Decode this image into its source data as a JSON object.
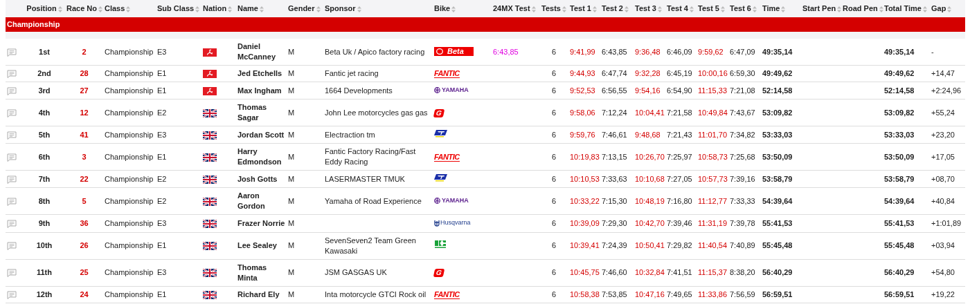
{
  "columns": [
    {
      "label": "Position"
    },
    {
      "label": "Race No"
    },
    {
      "label": "Class"
    },
    {
      "label": "Sub Class"
    },
    {
      "label": "Nation"
    },
    {
      "label": "Name"
    },
    {
      "label": "Gender"
    },
    {
      "label": "Sponsor"
    },
    {
      "label": "Bike"
    },
    {
      "label": "24MX Test"
    },
    {
      "label": "Tests"
    },
    {
      "label": "Test 1",
      "highlight": true
    },
    {
      "label": "Test 2",
      "highlight": false
    },
    {
      "label": "Test 3",
      "highlight": true
    },
    {
      "label": "Test 4",
      "highlight": false
    },
    {
      "label": "Test 5",
      "highlight": true
    },
    {
      "label": "Test 6",
      "highlight": false
    },
    {
      "label": "Time"
    },
    {
      "label": "Start Pen"
    },
    {
      "label": "Road Pen"
    },
    {
      "label": "Total Time"
    },
    {
      "label": "Gap"
    }
  ],
  "group": "Championship",
  "rows": [
    {
      "position": "1st",
      "race_no": "2",
      "class": "Championship",
      "sub_class": "E3",
      "nation": {
        "kind": "iom"
      },
      "name": "Daniel McCanney",
      "gender": "M",
      "sponsor": "Beta Uk / Apico factory racing",
      "bike": {
        "kind": "beta",
        "label": "Beta"
      },
      "mx_test": "6:43,85",
      "tests": "6",
      "test_times": [
        "9:41,99",
        "6:43,85",
        "9:36,48",
        "6:46,09",
        "9:59,62",
        "6:47,09"
      ],
      "time": "49:35,14",
      "total_time": "49:35,14",
      "gap": "-"
    },
    {
      "position": "2nd",
      "race_no": "28",
      "class": "Championship",
      "sub_class": "E1",
      "nation": {
        "kind": "iom"
      },
      "name": "Jed Etchells",
      "gender": "M",
      "sponsor": "Fantic jet racing",
      "bike": {
        "kind": "fantic",
        "label": "FANTIC"
      },
      "tests": "6",
      "test_times": [
        "9:44,93",
        "6:47,74",
        "9:32,28",
        "6:45,19",
        "10:00,16",
        "6:59,30"
      ],
      "time": "49:49,62",
      "total_time": "49:49,62",
      "gap": "+14,47"
    },
    {
      "position": "3rd",
      "race_no": "27",
      "class": "Championship",
      "sub_class": "E1",
      "nation": {
        "kind": "iom"
      },
      "name": "Max Ingham",
      "gender": "M",
      "sponsor": "1664 Developments",
      "bike": {
        "kind": "yamaha",
        "label": "YAMAHA"
      },
      "tests": "6",
      "test_times": [
        "9:52,53",
        "6:56,55",
        "9:54,16",
        "6:54,90",
        "11:15,33",
        "7:21,08"
      ],
      "time": "52:14,58",
      "total_time": "52:14,58",
      "gap": "+2:24,96"
    },
    {
      "position": "4th",
      "race_no": "12",
      "class": "Championship",
      "sub_class": "E2",
      "nation": {
        "kind": "gb"
      },
      "name": "Thomas Sagar",
      "gender": "M",
      "sponsor": "John Lee motorcycles gas gas",
      "bike": {
        "kind": "gasgas",
        "label": "G"
      },
      "tests": "6",
      "test_times": [
        "9:58,06",
        "7:12,24",
        "10:04,41",
        "7:21,58",
        "10:49,84",
        "7:43,67"
      ],
      "time": "53:09,82",
      "total_time": "53:09,82",
      "gap": "+55,24"
    },
    {
      "position": "5th",
      "race_no": "41",
      "class": "Championship",
      "sub_class": "E3",
      "nation": {
        "kind": "gb"
      },
      "name": "Jordan Scott",
      "gender": "M",
      "sponsor": "Electraction tm",
      "bike": {
        "kind": "tm"
      },
      "tests": "6",
      "test_times": [
        "9:59,76",
        "7:46,61",
        "9:48,68",
        "7:21,43",
        "11:01,70",
        "7:34,82"
      ],
      "time": "53:33,03",
      "total_time": "53:33,03",
      "gap": "+23,20"
    },
    {
      "position": "6th",
      "race_no": "3",
      "class": "Championship",
      "sub_class": "E1",
      "nation": {
        "kind": "gb"
      },
      "name": "Harry Edmondson",
      "gender": "M",
      "sponsor": "Fantic Factory Racing/Fast Eddy Racing",
      "bike": {
        "kind": "fantic",
        "label": "FANTIC"
      },
      "tests": "6",
      "test_times": [
        "10:19,83",
        "7:13,15",
        "10:26,70",
        "7:25,97",
        "10:58,73",
        "7:25,68"
      ],
      "time": "53:50,09",
      "total_time": "53:50,09",
      "gap": "+17,05"
    },
    {
      "position": "7th",
      "race_no": "22",
      "class": "Championship",
      "sub_class": "E2",
      "nation": {
        "kind": "gb"
      },
      "name": "Josh Gotts",
      "gender": "M",
      "sponsor": "LASERMASTER TMUK",
      "bike": {
        "kind": "tm"
      },
      "tests": "6",
      "test_times": [
        "10:10,53",
        "7:33,63",
        "10:10,68",
        "7:27,05",
        "10:57,73",
        "7:39,16"
      ],
      "time": "53:58,79",
      "total_time": "53:58,79",
      "gap": "+08,70"
    },
    {
      "position": "8th",
      "race_no": "5",
      "class": "Championship",
      "sub_class": "E2",
      "nation": {
        "kind": "gb"
      },
      "name": "Aaron Gordon",
      "gender": "M",
      "sponsor": "Yamaha of Road Experience",
      "bike": {
        "kind": "yamaha",
        "label": "YAMAHA"
      },
      "tests": "6",
      "test_times": [
        "10:33,22",
        "7:15,30",
        "10:48,19",
        "7:16,80",
        "11:12,77",
        "7:33,33"
      ],
      "time": "54:39,64",
      "total_time": "54:39,64",
      "gap": "+40,84"
    },
    {
      "position": "9th",
      "race_no": "36",
      "class": "Championship",
      "sub_class": "E3",
      "nation": {
        "kind": "gb"
      },
      "name": "Frazer Norrie",
      "gender": "M",
      "bike": {
        "kind": "husqvarna",
        "label": "Husqvarna"
      },
      "tests": "6",
      "test_times": [
        "10:39,09",
        "7:29,30",
        "10:42,70",
        "7:39,46",
        "11:31,19",
        "7:39,78"
      ],
      "time": "55:41,53",
      "total_time": "55:41,53",
      "gap": "+1:01,89"
    },
    {
      "position": "10th",
      "race_no": "26",
      "class": "Championship",
      "sub_class": "E1",
      "nation": {
        "kind": "gb"
      },
      "name": "Lee Sealey",
      "gender": "M",
      "sponsor": "SevenSeven2 Team Green Kawasaki",
      "bike": {
        "kind": "kawasaki"
      },
      "tests": "6",
      "test_times": [
        "10:39,41",
        "7:24,39",
        "10:50,41",
        "7:29,82",
        "11:40,54",
        "7:40,89"
      ],
      "time": "55:45,48",
      "total_time": "55:45,48",
      "gap": "+03,94"
    },
    {
      "position": "11th",
      "race_no": "25",
      "class": "Championship",
      "sub_class": "E3",
      "nation": {
        "kind": "gb"
      },
      "name": "Thomas Minta",
      "gender": "M",
      "sponsor": "JSM GASGAS UK",
      "bike": {
        "kind": "gasgas",
        "label": "G"
      },
      "tests": "6",
      "test_times": [
        "10:45,75",
        "7:46,60",
        "10:32,84",
        "7:41,51",
        "11:15,37",
        "8:38,20"
      ],
      "time": "56:40,29",
      "total_time": "56:40,29",
      "gap": "+54,80"
    },
    {
      "position": "12th",
      "race_no": "24",
      "class": "Championship",
      "sub_class": "E1",
      "nation": {
        "kind": "gb"
      },
      "name": "Richard Ely",
      "gender": "M",
      "sponsor": "Inta motorcycle GTCI Rock oil",
      "bike": {
        "kind": "fantic",
        "label": "FANTIC"
      },
      "tests": "6",
      "test_times": [
        "10:58,38",
        "7:53,85",
        "10:47,16",
        "7:49,65",
        "11:33,86",
        "7:56,59"
      ],
      "time": "56:59,51",
      "total_time": "56:59,51",
      "gap": "+19,22"
    }
  ]
}
